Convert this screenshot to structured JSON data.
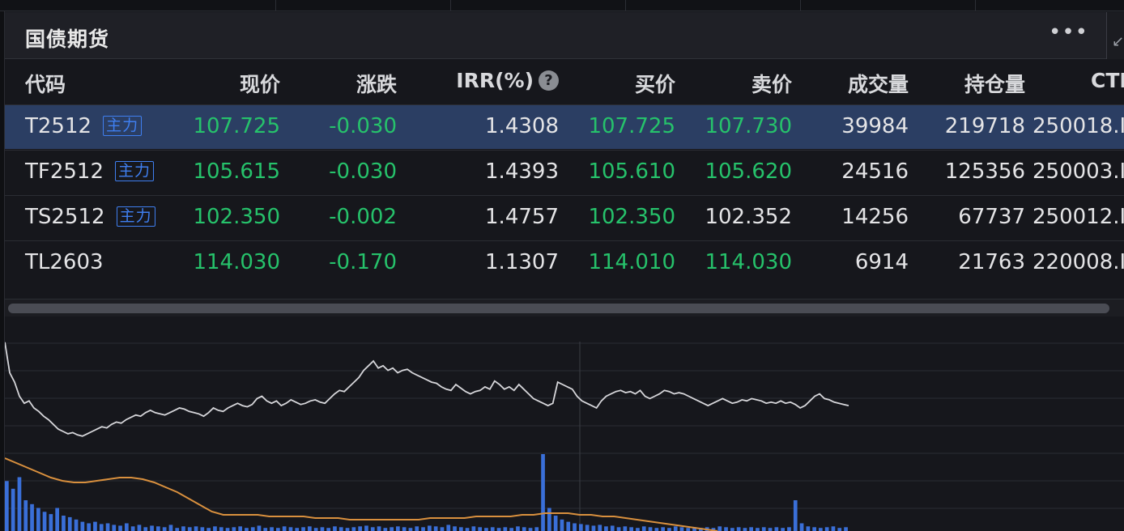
{
  "panel": {
    "title": "国债期货",
    "more": "•••",
    "stub": "↙"
  },
  "table": {
    "columns": {
      "code": "代码",
      "price": "现价",
      "change": "涨跌",
      "irr": "IRR(%)",
      "irr_help": "?",
      "bid": "买价",
      "ask": "卖价",
      "volume": "成交量",
      "open_interest": "持仓量",
      "ctd": "CTI"
    },
    "badge_label": "主力",
    "rows": [
      {
        "code": "T2512",
        "main": true,
        "price": "107.725",
        "change": "-0.030",
        "irr": "1.4308",
        "bid": "107.725",
        "ask": "107.730",
        "ask_color": "green",
        "volume": "39984",
        "open_interest": "219718",
        "ctd": "250018.I"
      },
      {
        "code": "TF2512",
        "main": true,
        "price": "105.615",
        "change": "-0.030",
        "irr": "1.4393",
        "bid": "105.610",
        "ask": "105.620",
        "ask_color": "green",
        "volume": "24516",
        "open_interest": "125356",
        "ctd": "250003.I"
      },
      {
        "code": "TS2512",
        "main": true,
        "price": "102.350",
        "change": "-0.002",
        "irr": "1.4757",
        "bid": "102.350",
        "ask": "102.352",
        "ask_color": "white",
        "volume": "14256",
        "open_interest": "67737",
        "ctd": "250012.I"
      },
      {
        "code": "TL2603",
        "main": false,
        "price": "114.030",
        "change": "-0.170",
        "irr": "1.1307",
        "bid": "114.010",
        "ask": "114.030",
        "ask_color": "green",
        "volume": "6914",
        "open_interest": "21763",
        "ctd": "220008.I"
      }
    ]
  },
  "colors": {
    "price_line": "#d6d6da",
    "avg_line": "#d9903e",
    "volume_bars": "#3a6fd8",
    "selected_row": "#2b3e63",
    "down": "#26c26b"
  },
  "chart_data": {
    "type": "line",
    "series": [
      {
        "values": [
          0.96,
          0.7,
          0.62,
          0.5,
          0.44,
          0.46,
          0.4,
          0.37,
          0.33,
          0.3,
          0.26,
          0.22,
          0.2,
          0.18,
          0.19,
          0.17,
          0.16,
          0.18,
          0.2,
          0.22,
          0.24,
          0.23,
          0.26,
          0.28,
          0.27,
          0.3,
          0.32,
          0.34,
          0.33,
          0.36,
          0.38,
          0.36,
          0.35,
          0.34,
          0.36,
          0.38,
          0.4,
          0.39,
          0.37,
          0.36,
          0.35,
          0.33,
          0.36,
          0.4,
          0.38,
          0.37,
          0.4,
          0.42,
          0.44,
          0.42,
          0.41,
          0.43,
          0.48,
          0.5,
          0.46,
          0.44,
          0.46,
          0.42,
          0.44,
          0.47,
          0.45,
          0.43,
          0.44,
          0.46,
          0.47,
          0.45,
          0.44,
          0.48,
          0.52,
          0.55,
          0.54,
          0.58,
          0.62,
          0.66,
          0.72,
          0.76,
          0.8,
          0.74,
          0.76,
          0.72,
          0.74,
          0.7,
          0.72,
          0.73,
          0.7,
          0.68,
          0.66,
          0.64,
          0.62,
          0.61,
          0.58,
          0.56,
          0.55,
          0.6,
          0.57,
          0.54,
          0.52,
          0.54,
          0.55,
          0.58,
          0.56,
          0.63,
          0.6,
          0.56,
          0.58,
          0.55,
          0.6,
          0.56,
          0.52,
          0.48,
          0.46,
          0.44,
          0.42,
          0.44,
          0.62,
          0.6,
          0.58,
          0.56,
          0.5,
          0.46,
          0.44,
          0.42,
          0.4,
          0.46,
          0.5,
          0.52,
          0.54,
          0.55,
          0.53,
          0.54,
          0.52,
          0.55,
          0.5,
          0.48,
          0.5,
          0.52,
          0.55,
          0.54,
          0.52,
          0.53,
          0.52,
          0.5,
          0.48,
          0.46,
          0.44,
          0.42,
          0.44,
          0.46,
          0.48,
          0.46,
          0.44,
          0.45,
          0.47,
          0.46,
          0.48,
          0.47,
          0.46,
          0.44,
          0.45,
          0.44,
          0.46,
          0.44,
          0.45,
          0.43,
          0.4,
          0.42,
          0.46,
          0.5,
          0.52,
          0.48,
          0.47,
          0.45,
          0.44,
          0.43,
          0.42
        ]
      },
      {
        "values": [
          0.45,
          0.42,
          0.39,
          0.36,
          0.33,
          0.31,
          0.3,
          0.3,
          0.31,
          0.32,
          0.33,
          0.33,
          0.32,
          0.3,
          0.27,
          0.24,
          0.2,
          0.16,
          0.12,
          0.1,
          0.1,
          0.1,
          0.1,
          0.09,
          0.09,
          0.09,
          0.09,
          0.08,
          0.08,
          0.08,
          0.07,
          0.07,
          0.07,
          0.07,
          0.07,
          0.07,
          0.07,
          0.08,
          0.08,
          0.08,
          0.08,
          0.09,
          0.09,
          0.09,
          0.09,
          0.1,
          0.1,
          0.11,
          0.11,
          0.11,
          0.1,
          0.1,
          0.09,
          0.09,
          0.08,
          0.07,
          0.06,
          0.05,
          0.04,
          0.03,
          0.02,
          0.01,
          0.0
        ]
      },
      {
        "values": [
          0.65,
          0.55,
          0.7,
          0.4,
          0.35,
          0.3,
          0.25,
          0.22,
          0.3,
          0.2,
          0.18,
          0.15,
          0.12,
          0.1,
          0.12,
          0.09,
          0.1,
          0.08,
          0.07,
          0.1,
          0.06,
          0.08,
          0.05,
          0.07,
          0.06,
          0.05,
          0.08,
          0.04,
          0.06,
          0.05,
          0.06,
          0.05,
          0.04,
          0.06,
          0.05,
          0.04,
          0.05,
          0.06,
          0.04,
          0.05,
          0.07,
          0.04,
          0.05,
          0.04,
          0.06,
          0.05,
          0.04,
          0.05,
          0.06,
          0.04,
          0.05,
          0.04,
          0.06,
          0.05,
          0.04,
          0.05,
          0.06,
          0.07,
          0.05,
          0.06,
          0.04,
          0.05,
          0.06,
          0.05,
          0.04,
          0.06,
          0.05,
          0.07,
          0.06,
          0.05,
          0.08,
          0.06,
          0.05,
          0.04,
          0.06,
          0.05,
          0.04,
          0.05,
          0.04,
          0.05,
          0.04,
          0.06,
          0.05,
          0.04,
          0.05,
          1.0,
          0.3,
          0.2,
          0.15,
          0.12,
          0.1,
          0.09,
          0.08,
          0.07,
          0.08,
          0.06,
          0.07,
          0.05,
          0.06,
          0.05,
          0.04,
          0.06,
          0.05,
          0.04,
          0.05,
          0.04,
          0.06,
          0.05,
          0.04,
          0.05,
          0.04,
          0.05,
          0.04,
          0.06,
          0.05,
          0.04,
          0.05,
          0.04,
          0.05,
          0.04,
          0.05,
          0.04,
          0.05,
          0.04,
          0.05,
          0.4,
          0.1,
          0.06,
          0.05,
          0.04,
          0.05,
          0.06,
          0.04,
          0.05
        ]
      }
    ]
  }
}
